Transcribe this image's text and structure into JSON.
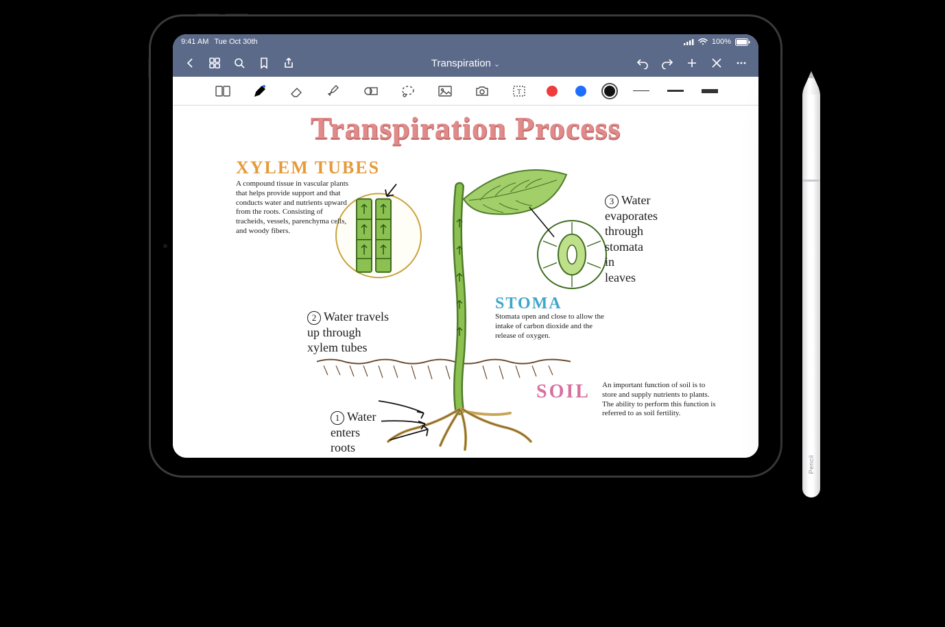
{
  "status": {
    "time": "9:41 AM",
    "date": "Tue Oct 30th",
    "battery_pct": "100%"
  },
  "nav": {
    "title": "Transpiration"
  },
  "colors": {
    "red": "#ef3b3b",
    "blue": "#1e6fff",
    "black": "#111111",
    "accent_bar": "#5c6a8a",
    "title_pink": "#e08a8a",
    "xylem_orange": "#e59a3c",
    "stoma_blue": "#3fa6c9",
    "soil_pink": "#d86fa0",
    "leaf_green": "#7ab648",
    "soil_brown": "#6b4a2e"
  },
  "strokes": {
    "thin": 1,
    "mid": 3,
    "thick": 6
  },
  "note": {
    "title": "Transpiration Process",
    "headings": {
      "xylem": "Xylem Tubes",
      "stoma": "Stoma",
      "soil": "Soil"
    },
    "xylem_desc": "A compound tissue in vascular plants that helps provide support and that conducts water and nutrients upward from the roots. Consisting of tracheids, vessels, parenchyma cells, and woody fibers.",
    "stoma_desc": "Stomata open and close to allow the intake of carbon dioxide and the release of oxygen.",
    "soil_desc": "An important function of soil is to store and supply nutrients to plants. The ability to perform this function is referred to as soil fertility.",
    "step1_num": "1",
    "step1": "Water\nenters\nroots",
    "step2_num": "2",
    "step2": "Water travels\nup through\nxylem tubes",
    "step3_num": "3",
    "step3": "Water\nevaporates\nthrough\nstomata\nin\nleaves"
  },
  "pencil_label": " Pencil"
}
